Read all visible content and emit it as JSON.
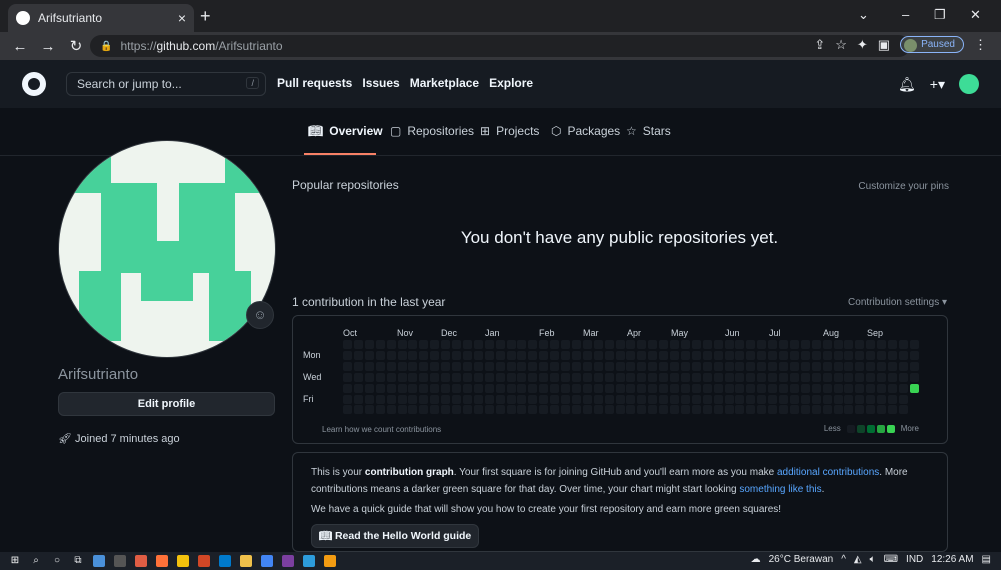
{
  "browser": {
    "tab_title": "Arifsutrianto",
    "tab_close": "×",
    "new_tab": "+",
    "url_prefix": "https://",
    "url_host": "github.com",
    "url_path": "/Arifsutrianto",
    "profile_status": "Paused",
    "win_min": "–",
    "win_max": "❐",
    "win_close": "✕"
  },
  "github": {
    "search_placeholder": "Search or jump to...",
    "search_key": "/",
    "nav": [
      "Pull requests",
      "Issues",
      "Marketplace",
      "Explore"
    ]
  },
  "profile_tabs": [
    {
      "label": "Overview",
      "icon": "book-icon"
    },
    {
      "label": "Repositories",
      "icon": "repo-icon"
    },
    {
      "label": "Projects",
      "icon": "table-icon"
    },
    {
      "label": "Packages",
      "icon": "package-icon"
    },
    {
      "label": "Stars",
      "icon": "star-icon"
    }
  ],
  "user": {
    "name": "Arifsutrianto",
    "edit_profile": "Edit profile",
    "joined": "Joined 7 minutes ago"
  },
  "popular": {
    "title": "Popular repositories",
    "customize": "Customize your pins",
    "empty": "You don't have any public repositories yet."
  },
  "contributions": {
    "title": "1 contribution in the last year",
    "settings": "Contribution settings ▾",
    "months": [
      "Oct",
      "Nov",
      "Dec",
      "Jan",
      "Feb",
      "Mar",
      "Apr",
      "May",
      "Jun",
      "Jul",
      "Aug",
      "Sep"
    ],
    "weekdays": [
      "Mon",
      "Wed",
      "Fri"
    ],
    "learn": "Learn how we count contributions",
    "less": "Less",
    "more": "More"
  },
  "info": {
    "p1_a": "This is your ",
    "p1_b": "contribution graph",
    "p1_c": ". Your first square is for joining GitHub and you'll earn more as you make ",
    "p1_link1": "additional contributions",
    "p1_d": ". More contributions means a darker green square for that day. Over time, your chart might start looking ",
    "p1_link2": "something like this",
    "p1_e": ".",
    "p2": "We have a quick guide that will show you how to create your first repository and earn more green squares!",
    "button": "Read the Hello World guide"
  },
  "taskbar": {
    "weather": "26°C Berawan",
    "lang": "IND",
    "time": "12:26 AM"
  },
  "colors": {
    "accent": "#f78166",
    "green": "#39d353",
    "link": "#58a6ff"
  }
}
